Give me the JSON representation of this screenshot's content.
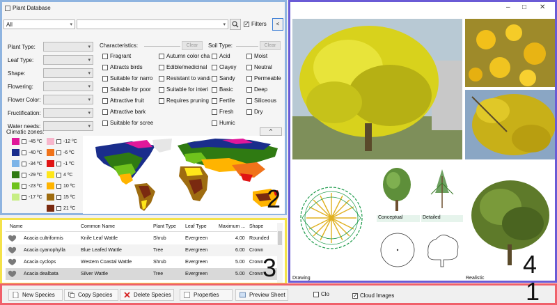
{
  "window": {
    "title": "Plant Database"
  },
  "search": {
    "category_value": "All",
    "query_value": "",
    "filters_label": "Filters",
    "filters_checked": true,
    "collapse_glyph": "<"
  },
  "filters": {
    "fields": [
      {
        "label": "Plant Type:"
      },
      {
        "label": "Leaf Type:"
      },
      {
        "label": "Shape:"
      },
      {
        "label": "Flowering:"
      },
      {
        "label": "Flower Color:"
      },
      {
        "label": "Fructification:"
      },
      {
        "label": "Water needs:"
      }
    ],
    "characteristics_label": "Characteristics:",
    "soil_label": "Soil Type:",
    "clear_label": "Clear",
    "characteristics_col1": [
      "Fragrant",
      "Attracts birds",
      "Suitable for narro",
      "Suitable for poor",
      "Attractive fruit",
      "Attractive bark",
      "Suitable for scree"
    ],
    "characteristics_col2": [
      "Autumn color cha",
      "Edible/medicinal",
      "Resistant to vanda",
      "Suitable for interi",
      "Requires pruning"
    ],
    "soil_col1": [
      "Acid",
      "Clayey",
      "Sandy",
      "Basic",
      "Fertile",
      "Fresh",
      "Humic"
    ],
    "soil_col2": [
      "Moist",
      "Neutral",
      "Permeable",
      "Deep",
      "Siliceous",
      "Dry"
    ],
    "climatic_label": "Climatic zones:",
    "collapse_up_glyph": "^",
    "zones_col1": [
      {
        "label": "-45 ºC",
        "color": "#e0189a"
      },
      {
        "label": "-40 ºC",
        "color": "#1a2d8c"
      },
      {
        "label": "-34 ºC",
        "color": "#7cb4e8"
      },
      {
        "label": "-29 ºC",
        "color": "#2f7a12"
      },
      {
        "label": "-23 ºC",
        "color": "#6fc21c"
      },
      {
        "label": "-17 ºC",
        "color": "#c7ee84"
      }
    ],
    "zones_col2": [
      {
        "label": "-12 ºC",
        "color": "#f7b6cc"
      },
      {
        "label": "-6 ºC",
        "color": "#f0731a"
      },
      {
        "label": "-1 ºC",
        "color": "#e01414"
      },
      {
        "label": "4 ºC",
        "color": "#ffe61a"
      },
      {
        "label": "10 ºC",
        "color": "#ffb400"
      },
      {
        "label": "15 ºC",
        "color": "#9e6c10"
      },
      {
        "label": "21 ºC",
        "color": "#7a2a10"
      }
    ]
  },
  "table": {
    "columns": [
      "Name",
      "Common Name",
      "Plant Type",
      "Leaf Type",
      "Maximum ...",
      "Shape"
    ],
    "rows": [
      {
        "name": "Acacia cultriformis",
        "common": "Knife Leaf Wattle",
        "type": "Shrub",
        "leaf": "Evergreen",
        "max": "4.00",
        "shape": "Rounded"
      },
      {
        "name": "Acacia cyanophylla",
        "common": "Blue Leafed Wattle",
        "type": "Tree",
        "leaf": "Evergreen",
        "max": "6.00",
        "shape": "Crown"
      },
      {
        "name": "Acacia cyclops",
        "common": "Western Coastal Wattle",
        "type": "Shrub",
        "leaf": "Evergreen",
        "max": "5.00",
        "shape": "Crown"
      },
      {
        "name": "Acacia dealbata",
        "common": "Silver Wattle",
        "type": "Tree",
        "leaf": "Evergreen",
        "max": "5.00",
        "shape": "Crown"
      }
    ],
    "selected_index": 3
  },
  "preview": {
    "captions": {
      "conceptual": "Conceptual",
      "detailed": "Detailed",
      "drawing": "Drawing",
      "realistic": "Realistic"
    }
  },
  "toolbar": {
    "new_species": "New Species",
    "copy_species": "Copy Species",
    "delete_species": "Delete Species",
    "properties": "Properties",
    "preview_sheet": "Preview Sheet",
    "clo_label": "Clo",
    "clo_checked": false,
    "cloud_images": "Cloud Images",
    "cloud_checked": true
  },
  "region_numbers": [
    "1",
    "2",
    "3",
    "4"
  ],
  "colors": {
    "filter_border": "#8fb4e0",
    "table_border": "#f4e24a",
    "image_border": "#6a5bd6",
    "toolbar_border": "#f0606a"
  }
}
